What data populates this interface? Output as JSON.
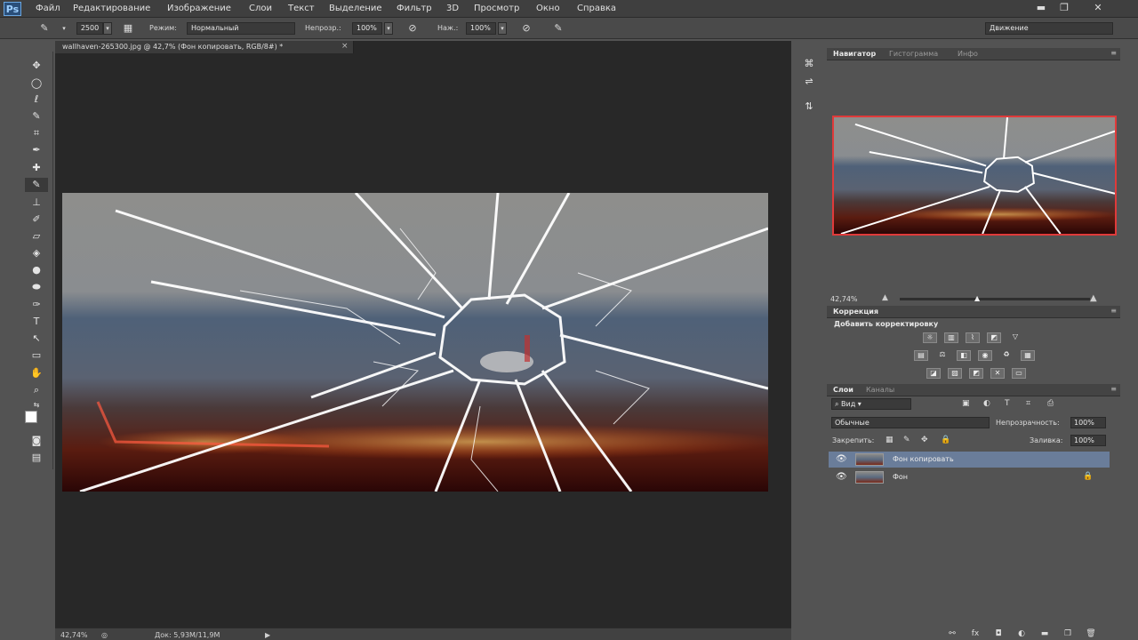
{
  "app": {
    "logo": "Ps"
  },
  "menu": [
    "Файл",
    "Редактирование",
    "Изображение",
    "Слои",
    "Текст",
    "Выделение",
    "Фильтр",
    "3D",
    "Просмотр",
    "Окно",
    "Справка"
  ],
  "window_controls": {
    "minimize": "▬",
    "restore": "❐",
    "close": "✕"
  },
  "options": {
    "brush_size": "2500",
    "mode_label": "Режим:",
    "mode_value": "Нормальный",
    "opacity_label": "Непрозр.:",
    "opacity_value": "100%",
    "flow_label": "Наж.:",
    "flow_value": "100%",
    "workspace": "Движение"
  },
  "document": {
    "tab_title": "wallhaven-265300.jpg @ 42,7% (Фон копировать, RGB/8#) *",
    "tab_close": "×"
  },
  "status": {
    "zoom": "42,74%",
    "doc_info": "Док: 5,93M/11,9M",
    "arrow": "▶"
  },
  "navigator": {
    "tabs": [
      "Навигатор",
      "Гистограмма",
      "Инфо"
    ],
    "zoom": "42,74%"
  },
  "adjustments": {
    "tab": "Коррекция",
    "title": "Добавить корректировку"
  },
  "layers": {
    "tabs": [
      "Слои",
      "Каналы"
    ],
    "kind_filter": "Вид",
    "blend_mode": "Обычные",
    "opacity_label": "Непрозрачность:",
    "opacity_value": "100%",
    "lock_label": "Закрепить:",
    "fill_label": "Заливка:",
    "fill_value": "100%",
    "items": [
      {
        "name": "Фон копировать",
        "selected": true
      },
      {
        "name": "Фон",
        "locked": true
      }
    ]
  },
  "colors": {
    "accent_selected_layer": "#6a7d9a",
    "navigator_frame": "#e03a3a",
    "panel_bg": "#535353",
    "canvas_bg": "#282828"
  }
}
